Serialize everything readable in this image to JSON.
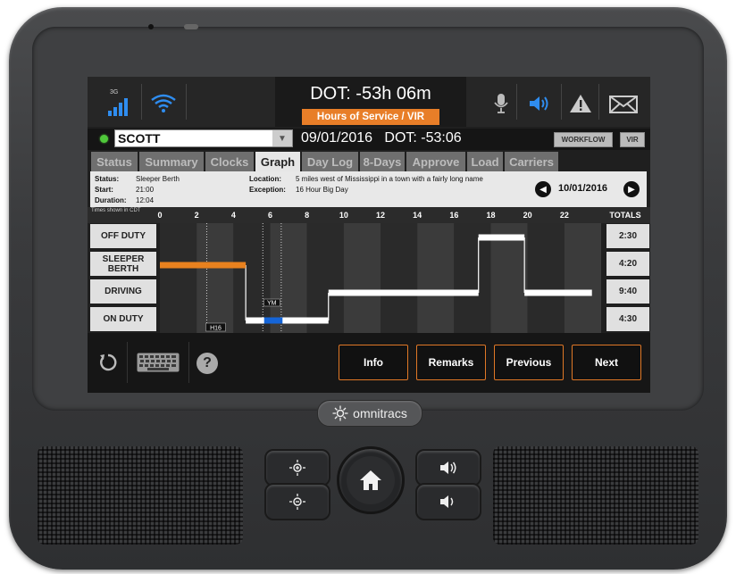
{
  "status_bar": {
    "network": "3G",
    "dot_time": "DOT: -53h 06m",
    "app_title": "Hours of Service / VIR",
    "icons": [
      "signal-icon",
      "wifi-icon",
      "microphone-icon",
      "speaker-icon",
      "warning-icon",
      "mail-icon"
    ]
  },
  "driver": {
    "name": "SCOTT",
    "date_status": "09/01/2016   DOT: -53:06",
    "workflow_label": "WORKFLOW",
    "vir_label": "VIR"
  },
  "tabs": [
    "Status",
    "Summary",
    "Clocks",
    "Graph",
    "Day Log",
    "8-Days",
    "Approve",
    "Load",
    "Carriers"
  ],
  "active_tab": "Graph",
  "info": {
    "status_label": "Status:",
    "status_value": "Sleeper Berth",
    "start_label": "Start:",
    "start_value": "21:00",
    "duration_label": "Duration:",
    "duration_value": "12:04",
    "location_label": "Location:",
    "location_value": "5 miles west of Mississippi in a town with a fairly long name",
    "exception_label": "Exception:",
    "exception_value": "16 Hour Big Day",
    "date": "10/01/2016"
  },
  "graph": {
    "tz_note": "Times shown in CDT",
    "hours": [
      "0",
      "2",
      "4",
      "6",
      "8",
      "10",
      "12",
      "14",
      "16",
      "18",
      "20",
      "22"
    ],
    "totals_label": "TOTALS",
    "rows": [
      {
        "label": "OFF DUTY",
        "total": "2:30"
      },
      {
        "label": "SLEEPER BERTH",
        "total": "4:20"
      },
      {
        "label": "DRIVING",
        "total": "9:40"
      },
      {
        "label": "ON DUTY",
        "total": "4:30"
      }
    ],
    "markers": {
      "h16": "H16",
      "ym": "YM"
    },
    "segments": [
      {
        "row": 1,
        "start": 0,
        "end": 4.67,
        "color": "#e8811e"
      },
      {
        "row": 3,
        "start": 4.67,
        "end": 9.17,
        "color": "#ffffff"
      },
      {
        "row": 3,
        "start": 5.67,
        "end": 6.67,
        "color": "#1565d8"
      },
      {
        "row": 2,
        "start": 9.17,
        "end": 17.33,
        "color": "#ffffff"
      },
      {
        "row": 0,
        "start": 17.33,
        "end": 19.83,
        "color": "#ffffff"
      },
      {
        "row": 2,
        "start": 19.83,
        "end": 23.5,
        "color": "#ffffff"
      }
    ],
    "transitions": [
      4.67,
      9.17,
      17.33,
      19.83
    ]
  },
  "actions": [
    "Info",
    "Remarks",
    "Previous",
    "Next"
  ],
  "device": {
    "brand": "omnitracs"
  }
}
